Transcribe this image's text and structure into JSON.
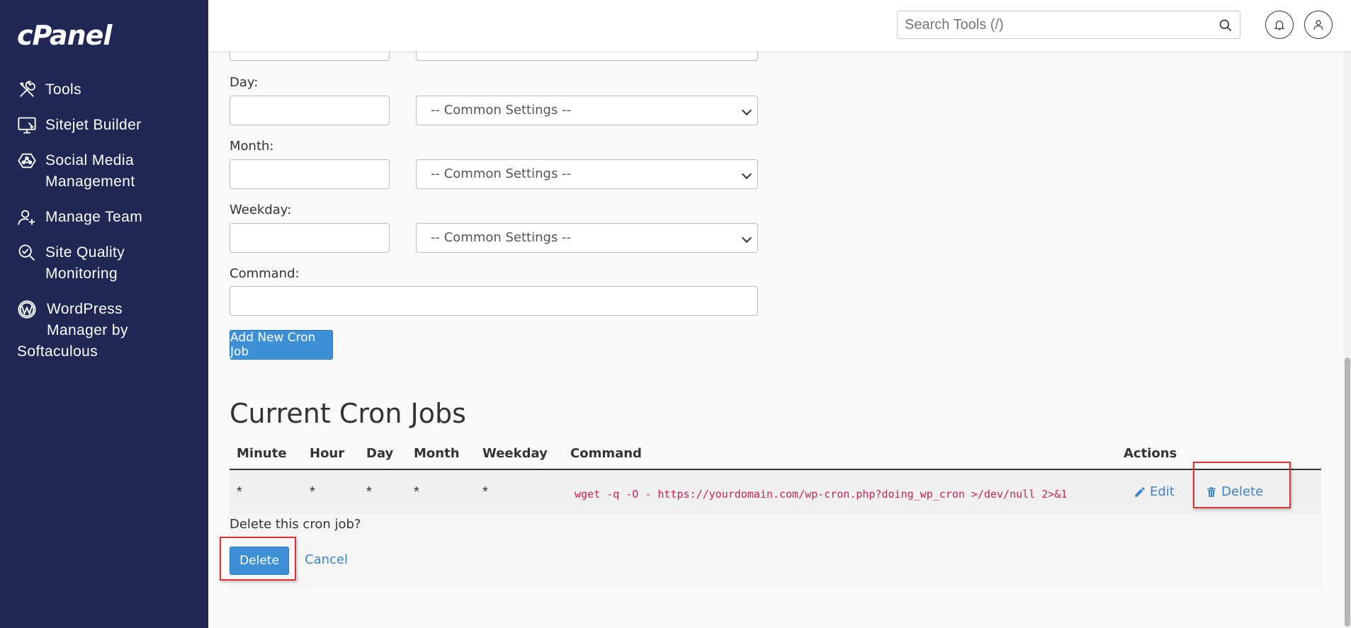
{
  "sidebar": {
    "logo": "cPanel",
    "items": [
      {
        "label": "Tools",
        "icon": "tools-icon"
      },
      {
        "label": "Sitejet Builder",
        "icon": "sitejet-icon"
      },
      {
        "label_line1": "Social Media",
        "label_line2": "Management",
        "icon": "social-media-icon"
      },
      {
        "label": "Manage Team",
        "icon": "manage-team-icon"
      },
      {
        "label_line1": "Site Quality",
        "label_line2": "Monitoring",
        "icon": "site-quality-icon"
      },
      {
        "label_line1": "WordPress",
        "label_line2": "Manager by",
        "label_line3": "Softaculous",
        "icon": "wordpress-icon"
      }
    ]
  },
  "topbar": {
    "search_placeholder": "Search Tools (/)"
  },
  "form": {
    "day_label": "Day:",
    "month_label": "Month:",
    "weekday_label": "Weekday:",
    "command_label": "Command:",
    "common_settings": "-- Common Settings --",
    "add_button": "Add New Cron Job"
  },
  "cron": {
    "title": "Current Cron Jobs",
    "headers": [
      "Minute",
      "Hour",
      "Day",
      "Month",
      "Weekday",
      "Command",
      "Actions"
    ],
    "row": {
      "minute": "*",
      "hour": "*",
      "day": "*",
      "month": "*",
      "weekday": "*",
      "command": "wget -q -O - https://yourdomain.com/wp-cron.php?doing_wp_cron >/dev/null 2>&1",
      "edit": "Edit",
      "delete": "Delete"
    },
    "confirm_text": "Delete this cron job?",
    "confirm_delete": "Delete",
    "confirm_cancel": "Cancel"
  },
  "colors": {
    "sidebar_bg": "#1f2754",
    "primary": "#3d8fd6",
    "link": "#3d85c6",
    "code": "#c7254e",
    "highlight": "#dd3333"
  }
}
